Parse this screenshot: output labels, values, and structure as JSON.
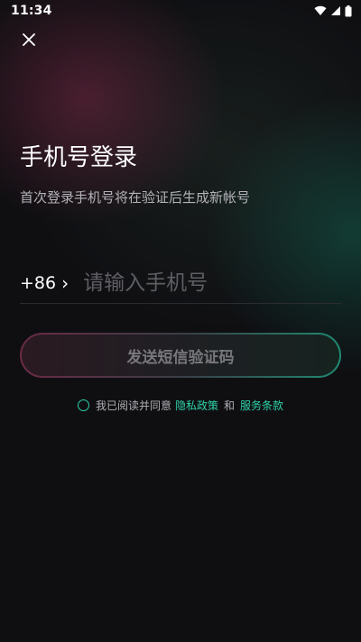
{
  "status_bar": {
    "time": "11:34",
    "icons": [
      "wifi-icon",
      "signal-icon",
      "battery-icon"
    ]
  },
  "header": {
    "close_icon": "close-icon"
  },
  "main": {
    "title": "手机号登录",
    "subtitle": "首次登录手机号将在验证后生成新帐号",
    "country_code": "+86",
    "country_chevron": "›",
    "phone_placeholder": "请输入手机号",
    "phone_value": "",
    "send_button_label": "发送短信验证码"
  },
  "agreement": {
    "prefix": "我已阅读并同意",
    "privacy_link": "隐私政策",
    "conjunction": "和",
    "terms_link": "服务条款",
    "checked": false
  },
  "colors": {
    "accent": "#2ed2a8",
    "background": "#0f0f12",
    "gradient_pink": "#6b2a45",
    "gradient_teal": "#1f8a72"
  }
}
